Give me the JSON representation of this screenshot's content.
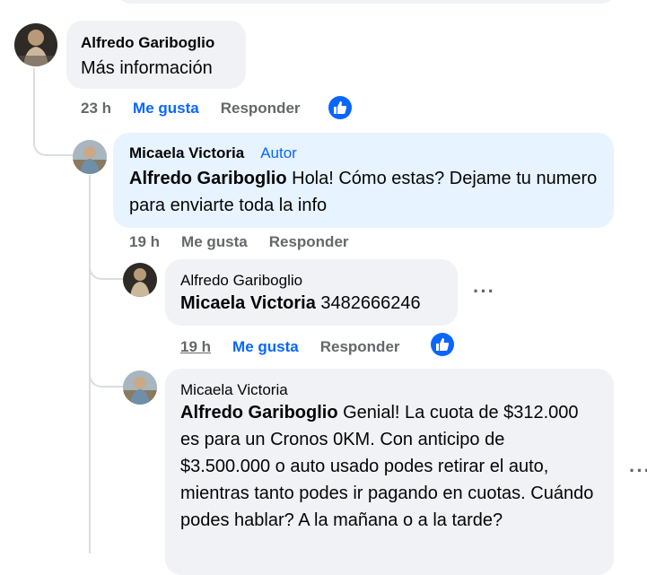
{
  "comments": [
    {
      "author": "Alfredo Gariboglio",
      "text": "Más información",
      "time": "23 h",
      "like_label": "Me gusta",
      "reply_label": "Responder"
    },
    {
      "author": "Micaela Victoria",
      "badge": "Autor",
      "mention": "Alfredo Gariboglio",
      "text": " Hola! Cómo estas? Dejame tu numero para enviarte toda la info",
      "time": "19 h",
      "like_label": "Me gusta",
      "reply_label": "Responder"
    },
    {
      "author": "Alfredo Gariboglio",
      "mention": "Micaela Victoria",
      "text": " 3482666246",
      "time": "19 h",
      "like_label": "Me gusta",
      "reply_label": "Responder",
      "more": "···"
    },
    {
      "author": "Micaela Victoria",
      "mention": "Alfredo Gariboglio",
      "text": " Genial! La cuota de $312.000 es para un Cronos 0KM. Con anticipo de $3.500.000 o auto usado podes retirar el auto, mientras tanto podes ir pagando en cuotas. Cuándo podes hablar? A la mañana o a la tarde?",
      "more": "···"
    }
  ],
  "colors": {
    "like_blue": "#0866ff",
    "meta_gray": "#65676b",
    "bubble_gray": "#f0f2f5",
    "author_bubble": "#e7f3ff",
    "thread_line": "#dadde1"
  },
  "icons": {
    "like_reaction": "thumbs-up-icon",
    "more_options": "more-options-icon"
  }
}
